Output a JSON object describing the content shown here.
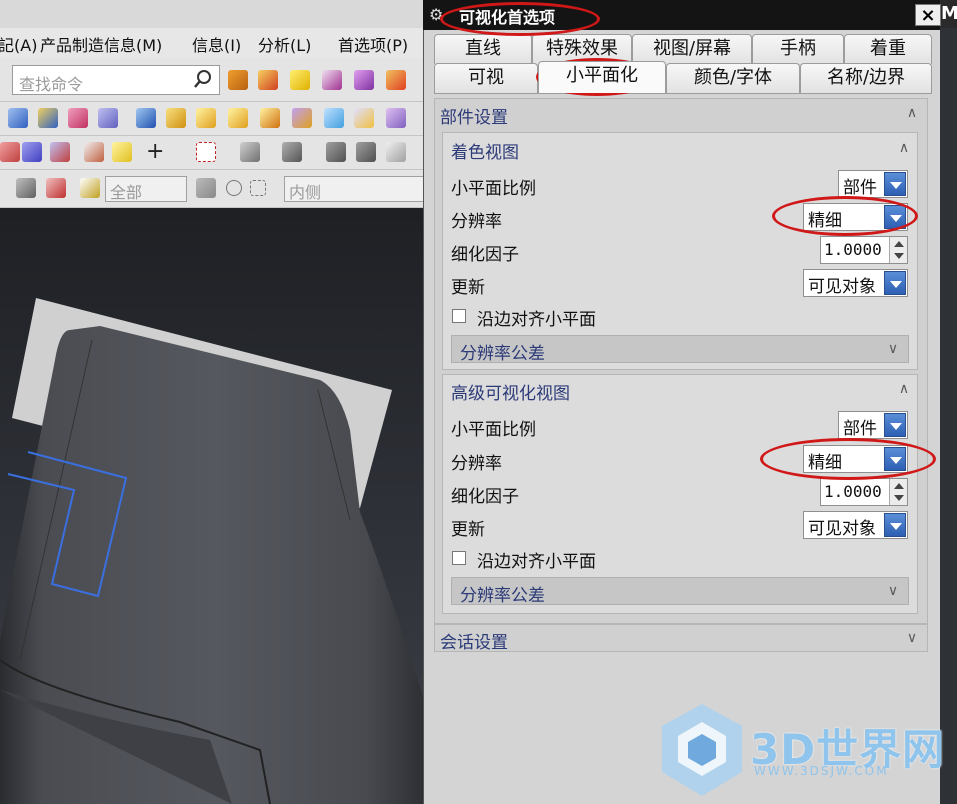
{
  "app": {
    "menu": [
      "記(A)",
      "产品制造信息(M)",
      "信息(I)",
      "分析(L)",
      "首选项(P)"
    ],
    "search_placeholder": "查找命令",
    "filter_all": "全部",
    "filter_inside": "内侧",
    "corner_letter": "M"
  },
  "dialog": {
    "title": "可视化首选项",
    "close_label": "×",
    "tabs_row1": [
      "直线",
      "特殊效果",
      "视图/屏幕",
      "手柄",
      "着重"
    ],
    "tabs_row2": [
      "可视",
      "小平面化",
      "颜色/字体",
      "名称/边界"
    ],
    "active_tab": "小平面化",
    "part_settings": "部件设置",
    "session_settings": "会话设置",
    "shaded_view": {
      "header": "着色视图",
      "facet_ratio_label": "小平面比例",
      "facet_ratio_value": "部件",
      "resolution_label": "分辨率",
      "resolution_value": "精细",
      "refine_label": "细化因子",
      "refine_value": "1.0000",
      "update_label": "更新",
      "update_value": "可见对象",
      "align_label": "沿边对齐小平面",
      "tolerance_label": "分辨率公差"
    },
    "advanced_view": {
      "header": "高级可视化视图",
      "facet_ratio_label": "小平面比例",
      "facet_ratio_value": "部件",
      "resolution_label": "分辨率",
      "resolution_value": "精细",
      "refine_label": "细化因子",
      "refine_value": "1.0000",
      "update_label": "更新",
      "update_value": "可见对象",
      "align_label": "沿边对齐小平面",
      "tolerance_label": "分辨率公差"
    }
  },
  "watermark": {
    "main": "3D世界网",
    "sub": "WWW.3DSJW.COM"
  },
  "colors": {
    "accent_blue": "#2d5fb3",
    "highlight_red": "#d01818",
    "header_text": "#2c3a78"
  }
}
